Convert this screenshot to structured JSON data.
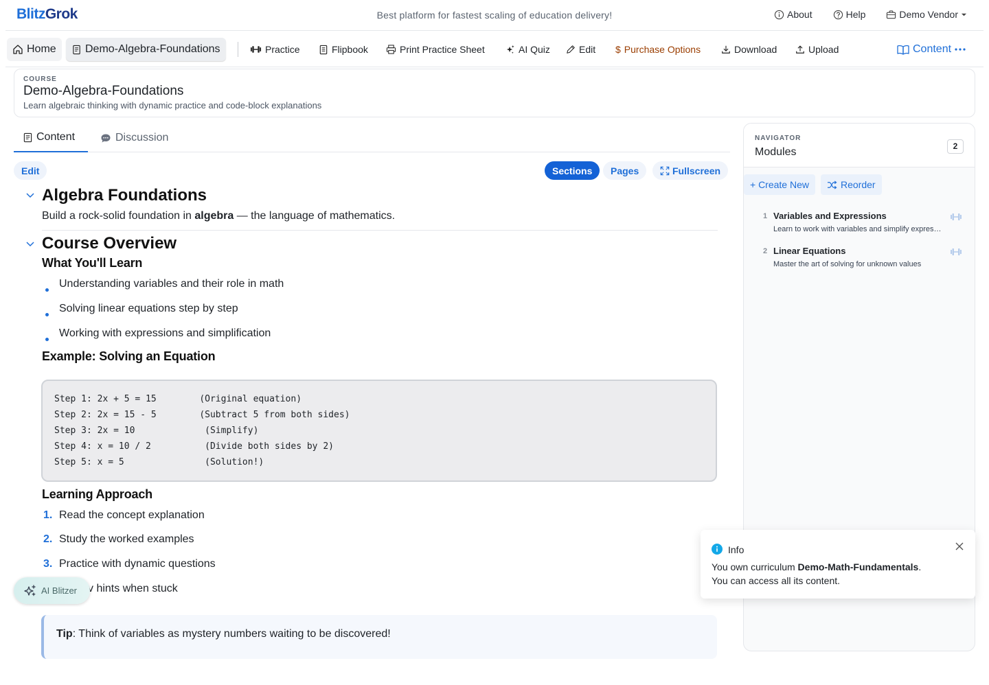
{
  "app": {
    "logo_part1": "Blitz",
    "logo_part2": "Grok",
    "tagline": "Best platform for fastest scaling of education delivery!"
  },
  "topnav": {
    "about": "About",
    "help": "Help",
    "vendor": "Demo Vendor"
  },
  "toolbar": {
    "home": "Home",
    "course": "Demo-Algebra-Foundations",
    "practice": "Practice",
    "flipbook": "Flipbook",
    "print": "Print Practice Sheet",
    "ai_quiz": "AI Quiz",
    "edit": "Edit",
    "purchase": "Purchase Options",
    "download": "Download",
    "upload": "Upload",
    "content": "Content"
  },
  "course": {
    "kicker": "COURSE",
    "title": "Demo-Algebra-Foundations",
    "description": "Learn algebraic thinking with dynamic practice and code-block explanations"
  },
  "tabs": {
    "content": "Content",
    "discussion": "Discussion"
  },
  "controls": {
    "edit": "Edit",
    "sections": "Sections",
    "pages": "Pages",
    "fullscreen": "Fullscreen"
  },
  "article": {
    "section1_title": "Algebra Foundations",
    "lead_before": "Build a rock-solid foundation in ",
    "lead_bold": "algebra",
    "lead_after": " — the language of mathematics.",
    "section2_title": "Course Overview",
    "learn_heading": "What You'll Learn",
    "learn_items": [
      "Understanding variables and their role in math",
      "Solving linear equations step by step",
      "Working with expressions and simplification"
    ],
    "example_heading": "Example: Solving an Equation",
    "code_lines": [
      "Step 1: 2x + 5 = 15        (Original equation)",
      "Step 2: 2x = 15 - 5        (Subtract 5 from both sides)",
      "Step 3: 2x = 10             (Simplify)",
      "Step 4: x = 10 / 2          (Divide both sides by 2)",
      "Step 5: x = 5               (Solution!)"
    ],
    "approach_heading": "Learning Approach",
    "approach_numbers": [
      "1.",
      "2.",
      "3."
    ],
    "approach_items": [
      "Read the concept explanation",
      "Study the worked examples",
      "Practice with dynamic questions",
      "v hints when stuck"
    ],
    "tip_label": "Tip",
    "tip_text": ": Think of variables as mystery numbers waiting to be discovered!"
  },
  "blitzer": {
    "label": "AI Blitzer"
  },
  "navigator": {
    "kicker": "NAVIGATOR",
    "title": "Modules",
    "count": "2",
    "create_new": "+ Create New",
    "reorder": "Reorder",
    "modules": [
      {
        "num": "1",
        "title": "Variables and Expressions",
        "desc": "Learn to work with variables and simplify expressions"
      },
      {
        "num": "2",
        "title": "Linear Equations",
        "desc": "Master the art of solving for unknown values"
      }
    ]
  },
  "toast": {
    "title": "Info",
    "msg_before": "You own curriculum ",
    "msg_bold": "Demo-Math-Fundamentals",
    "msg_after": ".",
    "msg_line2": "You can access all its content."
  },
  "colors": {
    "accent": "#1f6fd8",
    "sections_active": "#1462d6",
    "purchase": "#9a3d00",
    "info": "#13a8e8"
  },
  "icons": {
    "home": "home-icon",
    "course": "document-icon",
    "practice": "dumbbell-icon",
    "flipbook": "book-icon",
    "print": "printer-icon",
    "ai_quiz": "sparkles-icon",
    "edit": "pencil-icon",
    "purchase": "dollar-icon",
    "download": "download-icon",
    "upload": "upload-icon",
    "content": "open-book-icon",
    "more": "ellipsis-icon"
  }
}
